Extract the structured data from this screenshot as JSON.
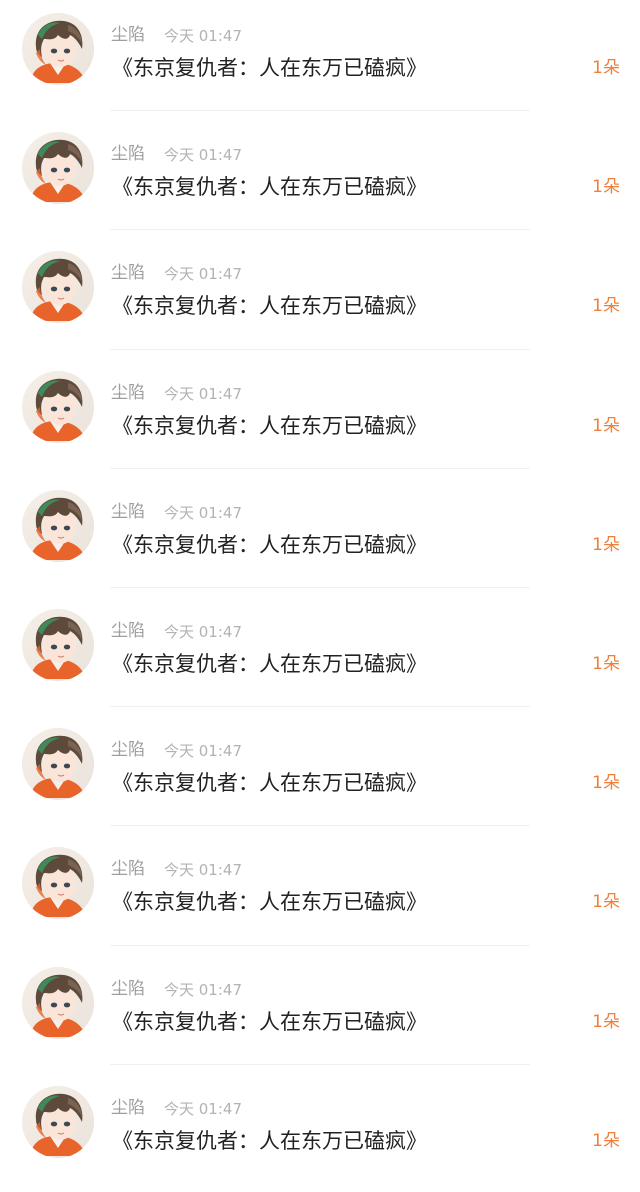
{
  "colors": {
    "username": "#9e9e9e",
    "time": "#b3b3b3",
    "title": "#222222",
    "count": "#ef7f3a",
    "divider": "#f0f0f0"
  },
  "entries": [
    {
      "avatar": "anime-boy-avatar-icon",
      "username": "尘陷",
      "time": "今天 01:47",
      "title": "《东京复仇者：人在东万已磕疯》",
      "count": "1朵"
    },
    {
      "avatar": "anime-boy-avatar-icon",
      "username": "尘陷",
      "time": "今天 01:47",
      "title": "《东京复仇者：人在东万已磕疯》",
      "count": "1朵"
    },
    {
      "avatar": "anime-boy-avatar-icon",
      "username": "尘陷",
      "time": "今天 01:47",
      "title": "《东京复仇者：人在东万已磕疯》",
      "count": "1朵"
    },
    {
      "avatar": "anime-boy-avatar-icon",
      "username": "尘陷",
      "time": "今天 01:47",
      "title": "《东京复仇者：人在东万已磕疯》",
      "count": "1朵"
    },
    {
      "avatar": "anime-boy-avatar-icon",
      "username": "尘陷",
      "time": "今天 01:47",
      "title": "《东京复仇者：人在东万已磕疯》",
      "count": "1朵"
    },
    {
      "avatar": "anime-boy-avatar-icon",
      "username": "尘陷",
      "time": "今天 01:47",
      "title": "《东京复仇者：人在东万已磕疯》",
      "count": "1朵"
    },
    {
      "avatar": "anime-boy-avatar-icon",
      "username": "尘陷",
      "time": "今天 01:47",
      "title": "《东京复仇者：人在东万已磕疯》",
      "count": "1朵"
    },
    {
      "avatar": "anime-boy-avatar-icon",
      "username": "尘陷",
      "time": "今天 01:47",
      "title": "《东京复仇者：人在东万已磕疯》",
      "count": "1朵"
    },
    {
      "avatar": "anime-boy-avatar-icon",
      "username": "尘陷",
      "time": "今天 01:47",
      "title": "《东京复仇者：人在东万已磕疯》",
      "count": "1朵"
    },
    {
      "avatar": "anime-boy-avatar-icon",
      "username": "尘陷",
      "time": "今天 01:47",
      "title": "《东京复仇者：人在东万已磕疯》",
      "count": "1朵"
    }
  ]
}
